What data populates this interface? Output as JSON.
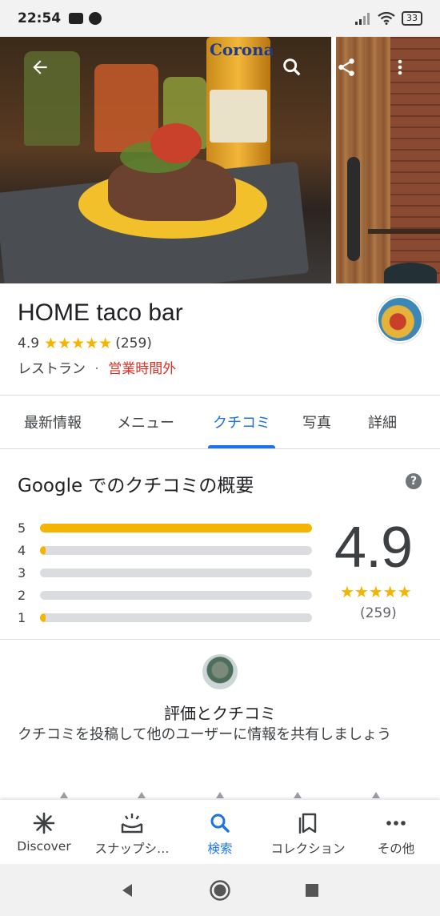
{
  "status_bar": {
    "time": "22:54",
    "battery": "33"
  },
  "place": {
    "name": "HOME taco bar",
    "rating": "4.9",
    "stars": "★★★★★",
    "review_count": "(259)",
    "category": "レストラン",
    "separator": "·",
    "hours_status": "営業時間外",
    "bottle_text": "Corona"
  },
  "tabs": [
    {
      "label": "最新情報",
      "active": false
    },
    {
      "label": "メニュー",
      "active": false
    },
    {
      "label": "クチコミ",
      "active": true
    },
    {
      "label": "写真",
      "active": false
    },
    {
      "label": "詳細",
      "active": false
    }
  ],
  "review_summary": {
    "title": "Google でのクチコミの概要",
    "help": "?",
    "rating": "4.9",
    "stars": "★★★★★",
    "count": "(259)",
    "distribution": [
      {
        "label": "5",
        "fraction": 1.0
      },
      {
        "label": "4",
        "fraction": 0.02
      },
      {
        "label": "3",
        "fraction": 0.0
      },
      {
        "label": "2",
        "fraction": 0.0
      },
      {
        "label": "1",
        "fraction": 0.02
      }
    ]
  },
  "rate_section": {
    "title": "評価とクチコミ",
    "description": "クチコミを投稿して他のユーザーに情報を共有しましょう"
  },
  "bottom_nav": [
    {
      "label": "Discover",
      "icon": "discover-icon",
      "active": false
    },
    {
      "label": "スナップシ…",
      "icon": "snapshot-icon",
      "active": false
    },
    {
      "label": "検索",
      "icon": "search-icon",
      "active": true
    },
    {
      "label": "コレクション",
      "icon": "collections-icon",
      "active": false
    },
    {
      "label": "その他",
      "icon": "more-dots-icon",
      "active": false
    }
  ],
  "colors": {
    "accent": "#1a73e8",
    "star": "#f4b400",
    "closed": "#d93025"
  }
}
